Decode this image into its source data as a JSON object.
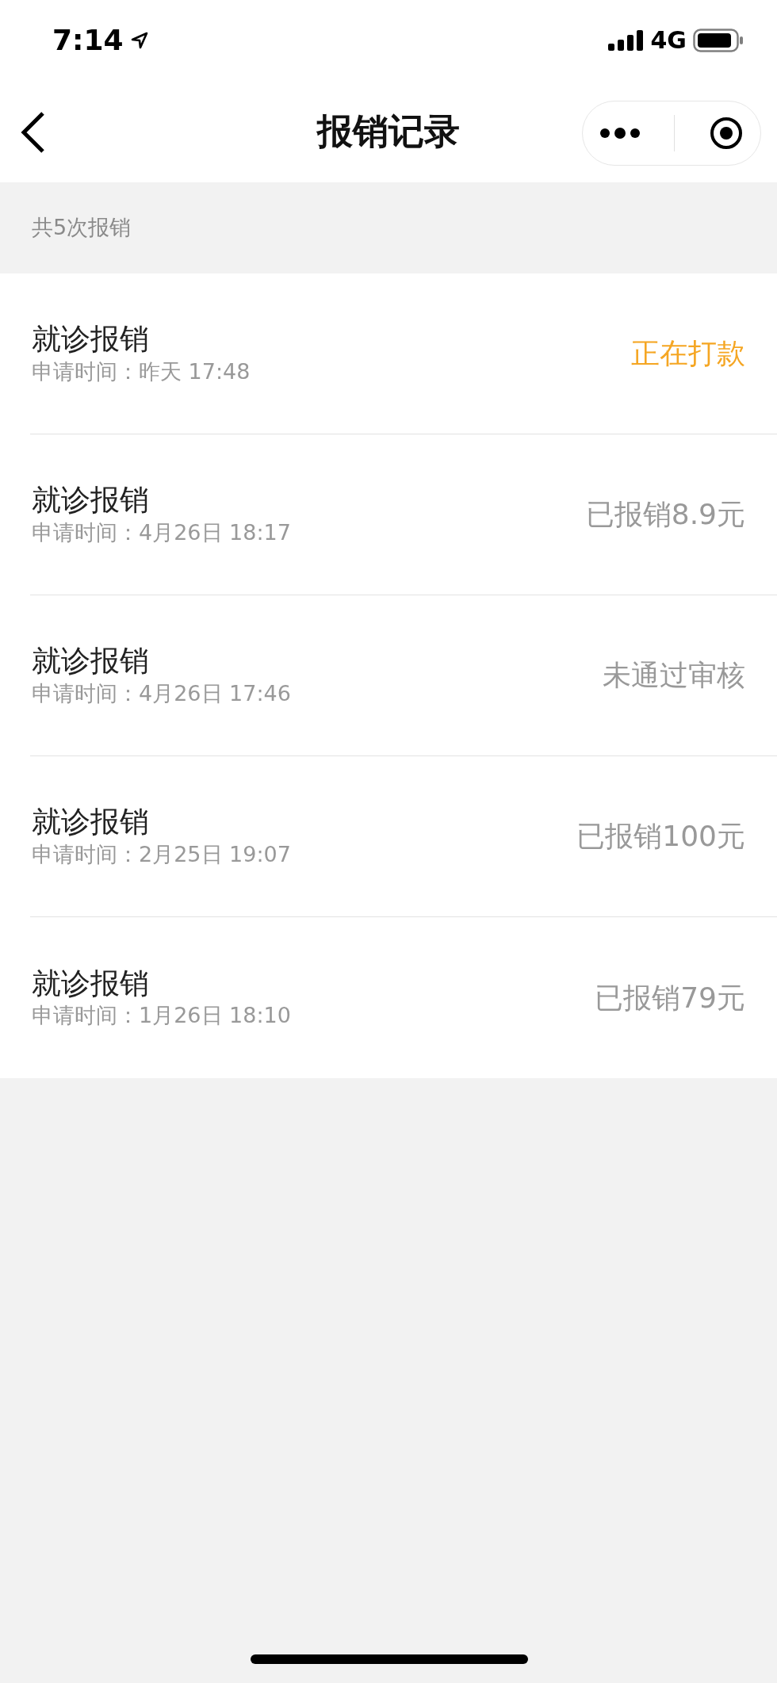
{
  "status_bar": {
    "time": "7:14",
    "network": "4G"
  },
  "nav": {
    "title": "报销记录"
  },
  "summary": "共5次报销",
  "records": [
    {
      "title": "就诊报销",
      "time": "申请时间：昨天 17:48",
      "status": "正在打款",
      "color": "#f5a623"
    },
    {
      "title": "就诊报销",
      "time": "申请时间：4月26日 18:17",
      "status": "已报销8.9元",
      "color": "#999999"
    },
    {
      "title": "就诊报销",
      "time": "申请时间：4月26日 17:46",
      "status": "未通过审核",
      "color": "#999999"
    },
    {
      "title": "就诊报销",
      "time": "申请时间：2月25日 19:07",
      "status": "已报销100元",
      "color": "#999999"
    },
    {
      "title": "就诊报销",
      "time": "申请时间：1月26日 18:10",
      "status": "已报销79元",
      "color": "#999999"
    }
  ]
}
